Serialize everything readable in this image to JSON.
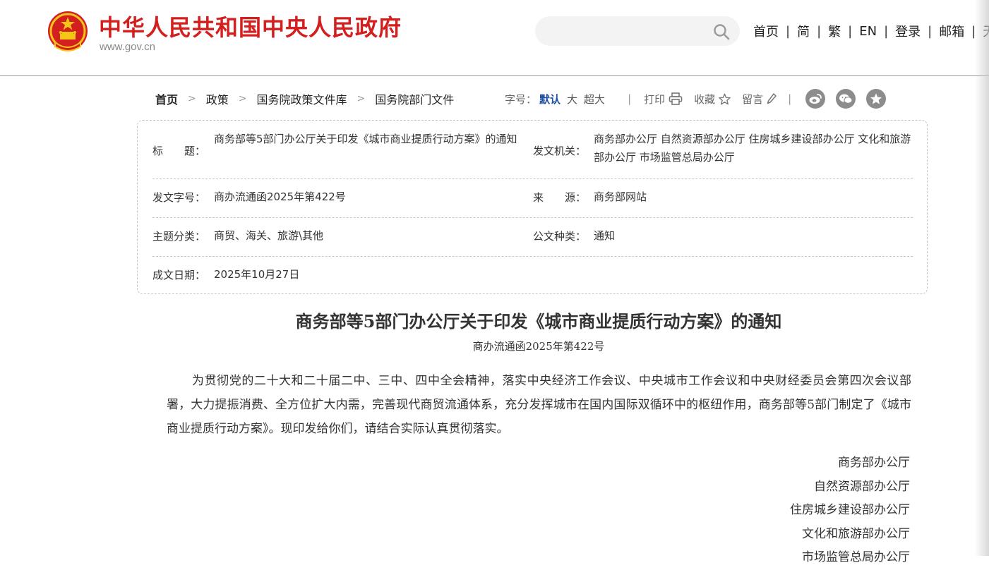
{
  "header": {
    "site_title": "中华人民共和国中央人民政府",
    "site_domain": "www.gov.cn",
    "nav": [
      "首页",
      "简",
      "繁",
      "EN",
      "登录",
      "邮箱",
      "无"
    ]
  },
  "breadcrumb": [
    "首页",
    "政策",
    "国务院政策文件库",
    "国务院部门文件"
  ],
  "toolbar": {
    "font_size_label": "字号：",
    "font_size_default": "默认",
    "font_size_large": "大",
    "font_size_xlarge": "超大",
    "print": "打印",
    "favorite": "收藏",
    "comment": "留言",
    "share_icons": [
      "weibo-icon",
      "wechat-icon",
      "star-icon"
    ]
  },
  "info": {
    "title_label": "标　　题：",
    "title_value": "商务部等5部门办公厅关于印发《城市商业提质行动方案》的通知",
    "issuer_label": "发文机关：",
    "issuer_value": "商务部办公厅  自然资源部办公厅  住房城乡建设部办公厅  文化和旅游部办公厅  市场监管总局办公厅",
    "doc_no_label": "发文字号：",
    "doc_no_value": "商办流通函2025年第422号",
    "source_label": "来　　源：",
    "source_value": "商务部网站",
    "topic_label": "主题分类：",
    "topic_value": "商贸、海关、旅游\\其他",
    "type_label": "公文种类：",
    "type_value": "通知",
    "date_label": "成文日期：",
    "date_value": "2025年10月27日"
  },
  "article": {
    "title": "商务部等5部门办公厅关于印发《城市商业提质行动方案》的通知",
    "doc_number": "商办流通函2025年第422号",
    "body": "为贯彻党的二十大和二十届二中、三中、四中全会精神，落实中央经济工作会议、中央城市工作会议和中央财经委员会第四次会议部署，大力提振消费、全方位扩大内需，完善现代商贸流通体系，充分发挥城市在国内国际双循环中的枢纽作用，商务部等5部门制定了《城市商业提质行动方案》。现印发给你们，请结合实际认真贯彻落实。",
    "signers": [
      "商务部办公厅",
      "自然资源部办公厅",
      "住房城乡建设部办公厅",
      "文化和旅游部办公厅",
      "市场监管总局办公厅"
    ]
  },
  "colors": {
    "brand_red": "#d41f1f",
    "link_blue": "#1b4fa0",
    "emblem_gold": "#f5c518"
  }
}
